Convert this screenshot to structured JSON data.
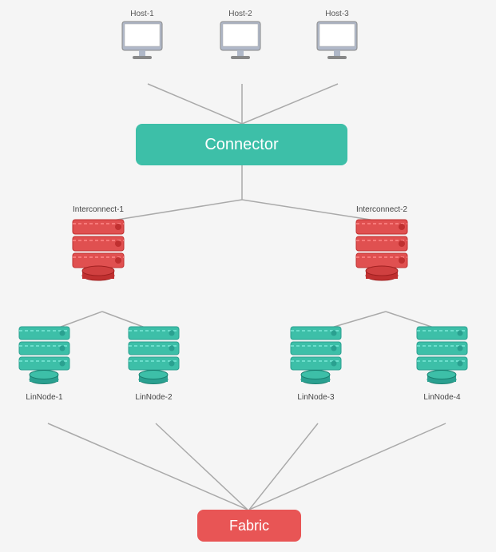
{
  "connector": {
    "label": "Connector",
    "color": "#3dbfa8"
  },
  "fabric": {
    "label": "Fabric",
    "color": "#e85555"
  },
  "computers": [
    {
      "id": "comp1",
      "label": "Host-1"
    },
    {
      "id": "comp2",
      "label": "Host-2"
    },
    {
      "id": "comp3",
      "label": "Host-3"
    }
  ],
  "large_servers": [
    {
      "id": "lsrv1",
      "label": "Interconnect-1"
    },
    {
      "id": "lsrv2",
      "label": "Interconnect-2"
    }
  ],
  "small_servers": [
    {
      "id": "ssrv1",
      "label": "LinNode-1"
    },
    {
      "id": "ssrv2",
      "label": "LinNode-2"
    },
    {
      "id": "ssrv3",
      "label": "LinNode-3"
    },
    {
      "id": "ssrv4",
      "label": "LinNode-4"
    }
  ]
}
